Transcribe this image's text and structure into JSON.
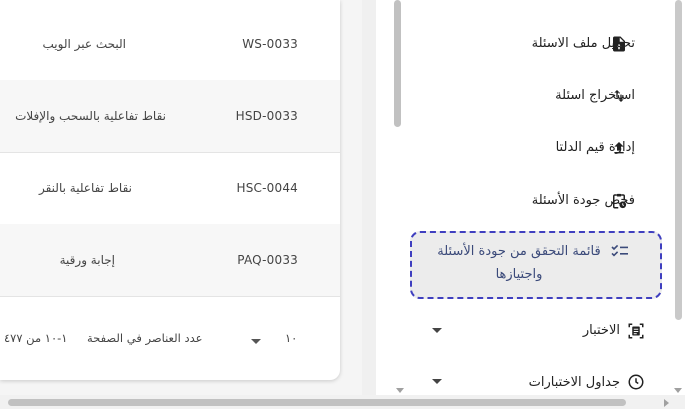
{
  "table": {
    "rows": [
      {
        "code": "WS-0033",
        "name": "البحث عبر الويب"
      },
      {
        "code": "HSD-0033",
        "name": "نقاط تفاعلية بالسحب والإفلات"
      },
      {
        "code": "HSC-0044",
        "name": "نقاط تفاعلية بالنقر"
      },
      {
        "code": "PAQ-0033",
        "name": "إجابة ورقية"
      }
    ]
  },
  "pagination": {
    "items_per_page_label": "عدد العناصر في الصفحة",
    "items_per_page_value": "١٠",
    "range_text": "١-١٠ من ٤٧٧"
  },
  "sidebar": {
    "items": [
      {
        "label": "تحميل ملف الاسئلة",
        "icon": "file-upload-icon"
      },
      {
        "label": "استخراج اسئلة",
        "icon": "swap-vertical-icon"
      },
      {
        "label": "إدارة قيم الدلتا",
        "icon": "upload-icon"
      },
      {
        "label": "فحص جودة الأسئلة",
        "icon": "clipboard-clock-icon"
      },
      {
        "label": "قائمة التحقق من جودة الأسئلة واجتيازها",
        "icon": "checklist-icon",
        "active": true
      },
      {
        "label": "الاختبار",
        "icon": "document-scan-icon",
        "expandable": true
      },
      {
        "label": "جداول الاختبارات",
        "icon": "clock-icon",
        "expandable": true
      }
    ]
  },
  "colors": {
    "active_border": "#3f3fbf",
    "active_text": "#3b4a7a",
    "active_bg": "#ececec"
  }
}
